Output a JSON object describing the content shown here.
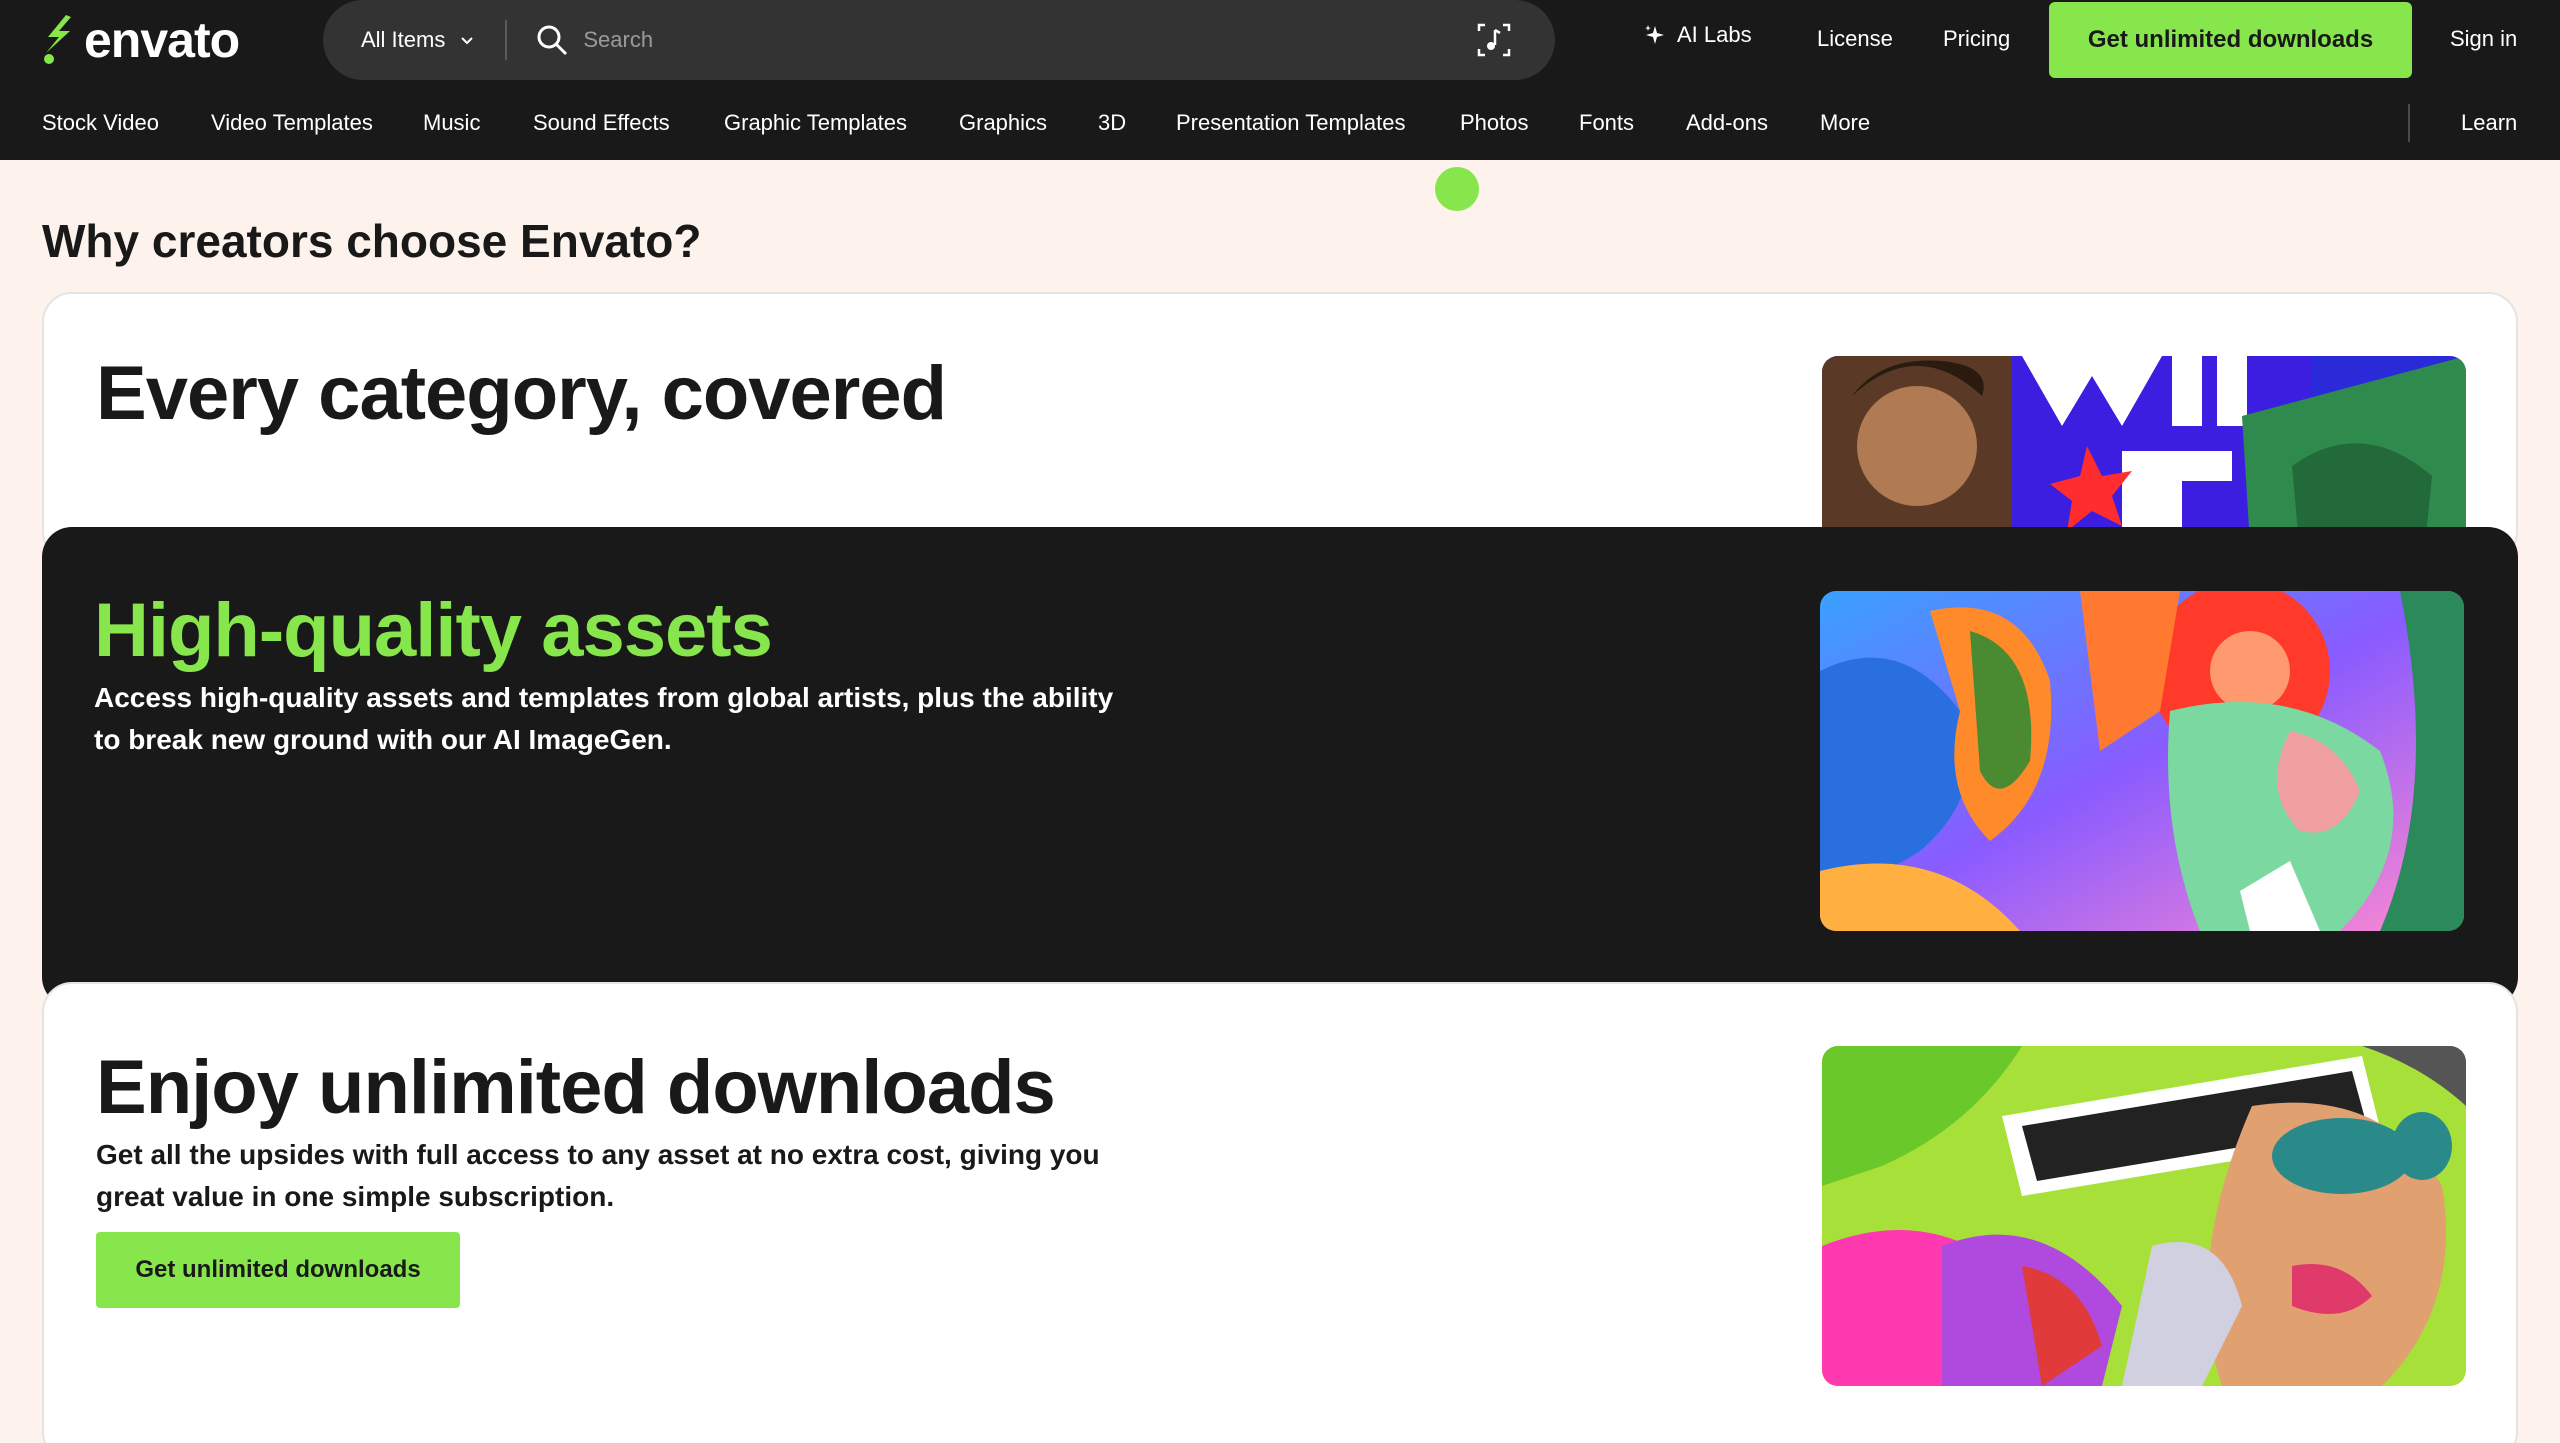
{
  "brand": {
    "name": "envato",
    "accent": "#87e64b",
    "dark": "#191919",
    "page_bg": "#fdf3ec"
  },
  "search": {
    "scope_label": "All Items",
    "placeholder": "Search",
    "value": ""
  },
  "top_nav": {
    "ai_labs": "AI Labs",
    "license": "License",
    "pricing": "Pricing",
    "cta": "Get unlimited downloads",
    "sign_in": "Sign in"
  },
  "categories": [
    "Stock Video",
    "Video Templates",
    "Music",
    "Sound Effects",
    "Graphic Templates",
    "Graphics",
    "3D",
    "Presentation Templates",
    "Photos",
    "Fonts",
    "Add-ons",
    "More"
  ],
  "learn": "Learn",
  "section_title": "Why creators choose Envato?",
  "cards": [
    {
      "heading": "Every category, covered",
      "body": ""
    },
    {
      "heading": "High-quality assets",
      "body": "Access high-quality assets and templates from global artists, plus the ability to break new ground with our AI ImageGen."
    },
    {
      "heading": "Enjoy unlimited downloads",
      "body": "Get all the upsides with full access to any asset at no extra cost, giving you great value in one simple subscription.",
      "cta": "Get unlimited downloads"
    }
  ],
  "icons": {
    "logo": "envato-leaf-logo",
    "dropdown": "chevron-down-icon",
    "search": "search-icon",
    "audio_search": "audio-search-icon",
    "ai": "sparkle-icon"
  }
}
